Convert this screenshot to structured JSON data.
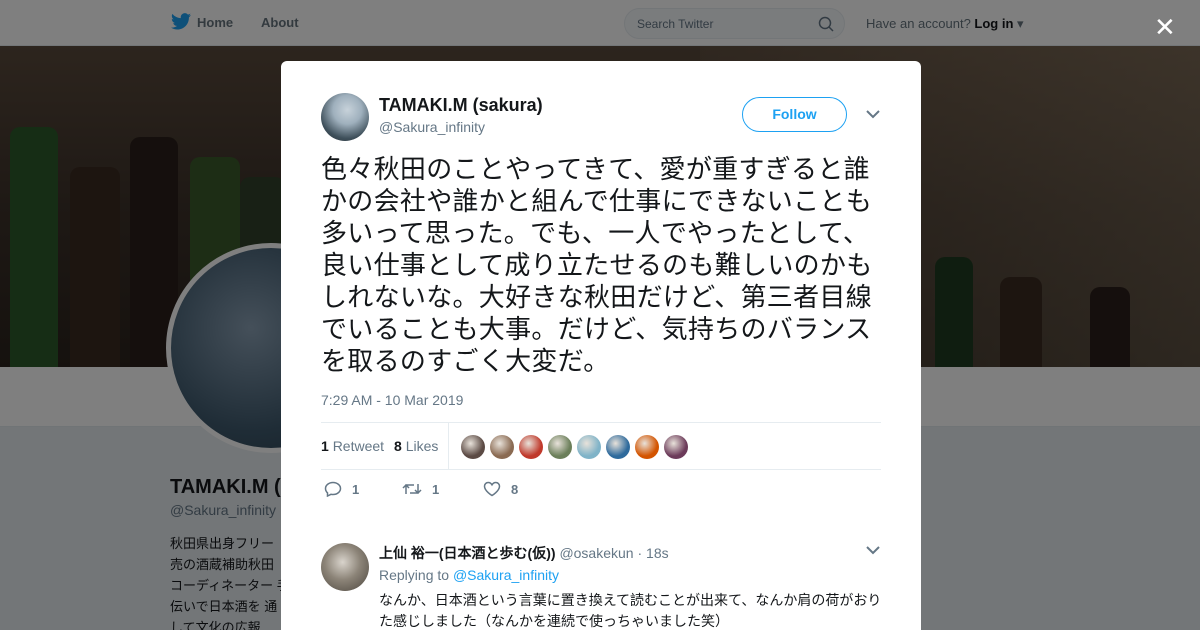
{
  "nav": {
    "home_label": "Home",
    "about_label": "About",
    "search_placeholder": "Search Twitter",
    "account_prompt": "Have an account?",
    "login_label": "Log in"
  },
  "profile": {
    "name": "TAMAKI.M (",
    "handle": "@Sakura_infinity",
    "bio": "秋田県出身フリー 売の酒蔵補助秋田 コーディネーター 手伝いで日本酒を 通して文化の広報"
  },
  "tweet": {
    "author_name": "TAMAKI.M (sakura)",
    "author_handle": "@Sakura_infinity",
    "follow_label": "Follow",
    "text": "色々秋田のことやってきて、愛が重すぎると誰かの会社や誰かと組んで仕事にできないことも多いって思った。でも、一人でやったとして、良い仕事として成り立たせるのも難しいのかもしれないな。大好きな秋田だけど、第三者目線でいることも大事。だけど、気持ちのバランスを取るのすごく大変だ。",
    "timestamp": "7:29 AM - 10 Mar 2019",
    "retweet_count": "1",
    "retweet_label": "Retweet",
    "likes_count": "8",
    "likes_label": "Likes",
    "likers": [
      "#5b4a44",
      "#8a6a52",
      "#c0392b",
      "#6b7f5a",
      "#7fb3c8",
      "#2e6a9c",
      "#d35400",
      "#6c3b5a"
    ],
    "actions": {
      "reply_count": "1",
      "retweet_count": "1",
      "like_count": "8"
    }
  },
  "reply": {
    "name": "上仙 裕一(日本酒と歩む(仮))",
    "handle": "@osakekun",
    "time": "· 18s",
    "replying_prefix": "Replying to",
    "replying_to": "@Sakura_infinity",
    "text": "なんか、日本酒という言葉に置き換えて読むことが出来て、なんか肩の荷がおりた感じしました（なんかを連続で使っちゃいました笑）"
  },
  "colors": {
    "brand": "#1da1f2",
    "text_secondary": "#657786"
  }
}
